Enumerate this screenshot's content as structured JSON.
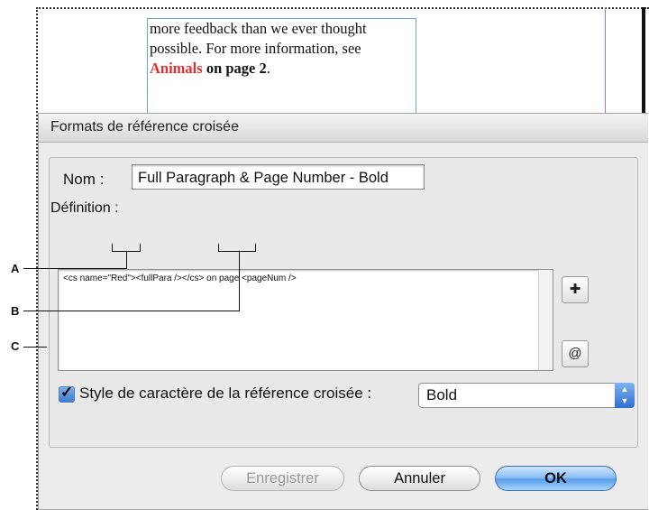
{
  "document": {
    "line1": "more feedback than we ever thought",
    "line2": "possible. For more information, see",
    "link_name": "Animals",
    "link_page": " on page 2",
    "period": "."
  },
  "dialog": {
    "title": "Formats de référence croisée",
    "nom_label": "Nom :",
    "nom_value": "Full Paragraph & Page Number - Bold",
    "definition_label": "Définition :",
    "definition_value": "<cs name=\"Red\"><fullPara /></cs> on page <pageNum />",
    "insert_button_icon": "insert-text-icon",
    "insert_button_glyph": "✚",
    "at_button_glyph": "@",
    "char_style_checked": true,
    "char_style_label": "Style de caractère de la référence croisée :",
    "char_style_value": "Bold",
    "buttons": {
      "save": "Enregistrer",
      "cancel": "Annuler",
      "ok": "OK"
    }
  },
  "callouts": [
    "A",
    "B",
    "C"
  ]
}
